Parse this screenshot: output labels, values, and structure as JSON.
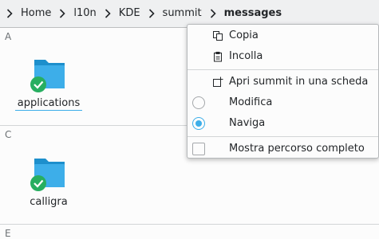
{
  "breadcrumb": {
    "items": [
      "Home",
      "l10n",
      "KDE",
      "summit"
    ],
    "current": "messages"
  },
  "groups": [
    {
      "letter": "A",
      "items": [
        {
          "name": "applications",
          "icon": "folder-icon",
          "status": "synced-check"
        }
      ]
    },
    {
      "letter": "C",
      "items": [
        {
          "name": "calligra",
          "icon": "folder-icon",
          "status": "synced-check"
        }
      ]
    },
    {
      "letter": "E",
      "items": []
    }
  ],
  "context_menu": {
    "copy": {
      "label": "Copia",
      "icon": "copy-icon"
    },
    "paste": {
      "label": "Incolla",
      "icon": "paste-icon"
    },
    "open_tab": {
      "label": "Apri summit in una scheda",
      "icon": "tab-new-icon"
    },
    "edit": {
      "label": "Modifica",
      "checked": false
    },
    "navigate": {
      "label": "Naviga",
      "checked": true
    },
    "full_path": {
      "label": "Mostra percorso completo",
      "checked": false
    }
  },
  "colors": {
    "accent": "#3daee9",
    "folder": "#3daee9",
    "badge": "#27ae60"
  }
}
